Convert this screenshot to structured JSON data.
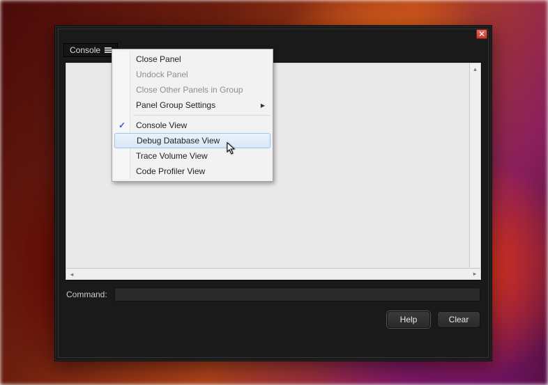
{
  "tab": {
    "label": "Console"
  },
  "command": {
    "label": "Command:",
    "value": ""
  },
  "buttons": {
    "help": "Help",
    "clear": "Clear"
  },
  "menu": {
    "close_panel": "Close Panel",
    "undock_panel": "Undock Panel",
    "close_others": "Close Other Panels in Group",
    "panel_group_settings": "Panel Group Settings",
    "console_view": "Console View",
    "debug_database_view": "Debug Database View",
    "trace_volume_view": "Trace Volume View",
    "code_profiler_view": "Code Profiler View"
  }
}
